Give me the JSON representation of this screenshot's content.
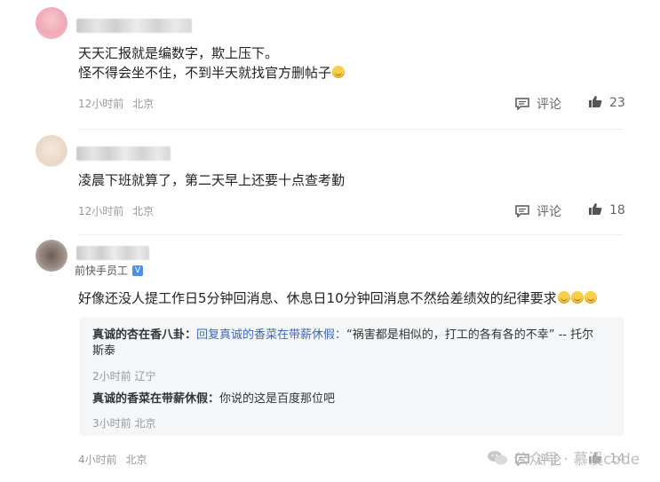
{
  "comments": [
    {
      "text_lines": [
        "天天汇报就是编数字，欺上压下。",
        "怪不得会坐不住，不到半天就找官方删帖子"
      ],
      "time": "12小时前",
      "location": "北京",
      "reply_label": "评论",
      "likes": "23",
      "emoji_count": 1
    },
    {
      "text_lines": [
        "凌晨下班就算了，第二天早上还要十点查考勤"
      ],
      "time": "12小时前",
      "location": "北京",
      "reply_label": "评论",
      "likes": "18"
    },
    {
      "badge": "前快手员工",
      "text_lines": [
        "好像还没人提工作日5分钟回消息、休息日10分钟回消息不然给差绩效的纪律要求"
      ],
      "emoji_count": 3,
      "time": "4小时前",
      "location": "北京",
      "reply_label": "评论",
      "likes": "14",
      "replies": [
        {
          "author": "真诚的杏在香八卦：",
          "reply_to": "回复真诚的香菜在带薪休假：",
          "text_line1": "“祸害都是相似的，打工的各有各的不幸” -- 托尔",
          "text_line2": "斯泰",
          "time": "2小时前",
          "location": "辽宁"
        },
        {
          "author": "真诚的香菜在带薪休假：",
          "text": "你说的这是百度那位吧",
          "time": "3小时前",
          "location": "北京"
        }
      ]
    }
  ],
  "watermark": {
    "text": "公众号 · 慕溪code"
  },
  "colors": {
    "link": "#3f68b3",
    "meta": "#999999",
    "reply_bg": "#f5f6f8",
    "badge": "#4d8ee8"
  }
}
